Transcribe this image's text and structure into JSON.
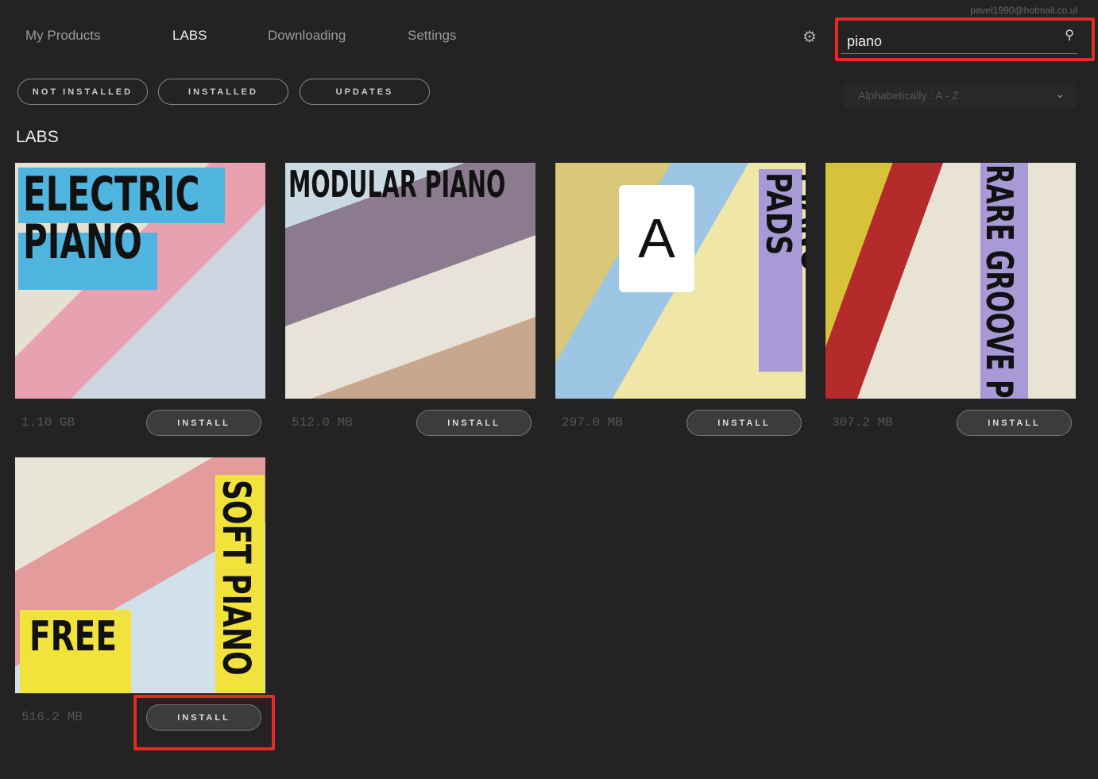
{
  "account": {
    "email": "pavel1990@hotmail.co.ul"
  },
  "nav": [
    {
      "label": "My Products"
    },
    {
      "label": "LABS",
      "active": true
    },
    {
      "label": "Downloading"
    },
    {
      "label": "Settings"
    }
  ],
  "search": {
    "value": "piano"
  },
  "filters": [
    {
      "label": "NOT INSTALLED"
    },
    {
      "label": "INSTALLED"
    },
    {
      "label": "UPDATES"
    }
  ],
  "sort": {
    "selected": "Alphabetically : A - Z"
  },
  "section_title": "LABS",
  "products": [
    {
      "title": "ELECTRIC PIANO",
      "size": "1.10 GB",
      "button": "INSTALL"
    },
    {
      "title": "MODULAR PIANO",
      "size": "512.0 MB",
      "button": "INSTALL"
    },
    {
      "title": "PIANO PADS",
      "size": "297.0 MB",
      "button": "INSTALL"
    },
    {
      "title": "RARE GROOVE PIANO",
      "size": "307.2 MB",
      "button": "INSTALL"
    },
    {
      "title": "SOFT PIANO",
      "badge": "FREE",
      "size": "516.2 MB",
      "button": "INSTALL"
    }
  ],
  "colors": {
    "highlight": "#e32b24",
    "background": "#232323"
  }
}
